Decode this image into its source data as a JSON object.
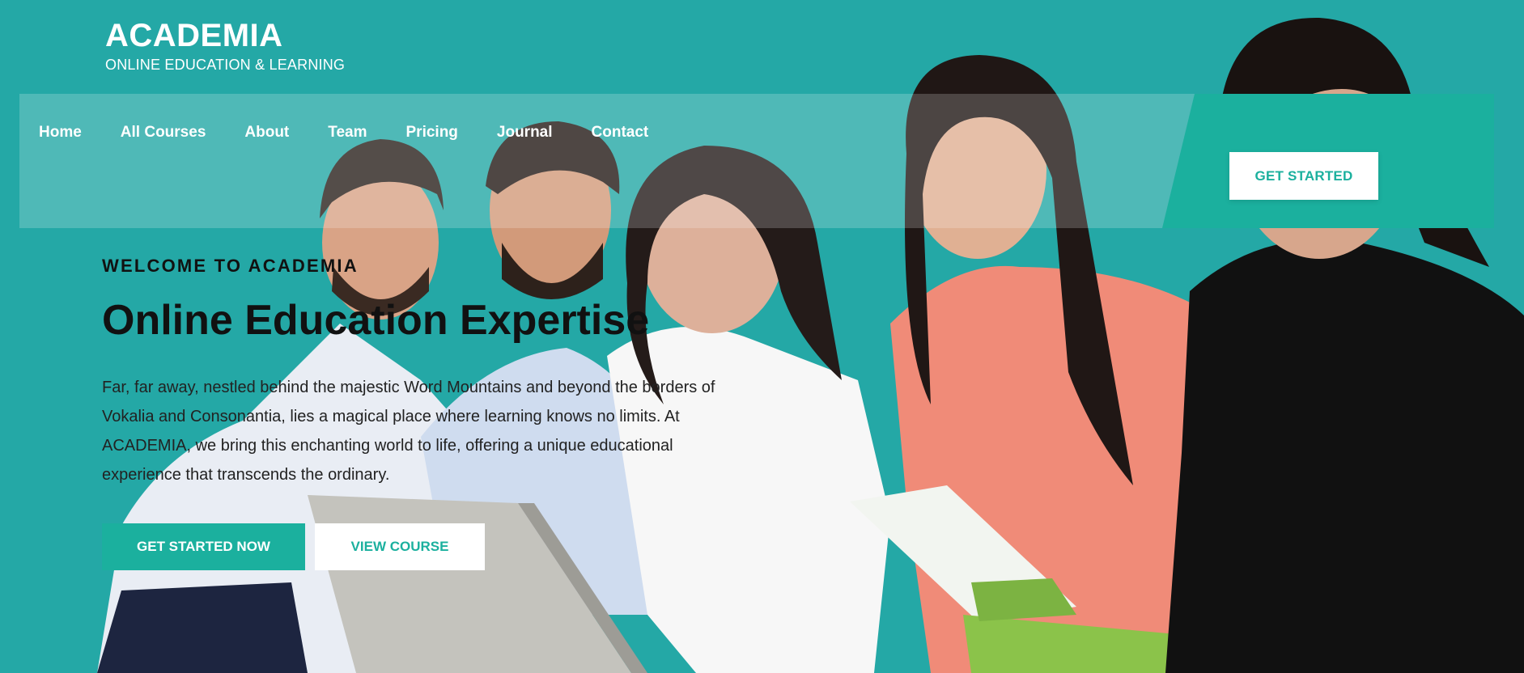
{
  "brand": {
    "name": "ACADEMIA",
    "tagline": "ONLINE EDUCATION & LEARNING"
  },
  "nav": {
    "items": [
      {
        "label": "Home"
      },
      {
        "label": "All Courses"
      },
      {
        "label": "About"
      },
      {
        "label": "Team"
      },
      {
        "label": "Pricing"
      },
      {
        "label": "Journal"
      },
      {
        "label": "Contact"
      }
    ],
    "cta": "GET STARTED"
  },
  "hero": {
    "eyebrow": "WELCOME TO ACADEMIA",
    "title": "Online Education Expertise",
    "description": "Far, far away, nestled behind the majestic Word Mountains and beyond the borders of Vokalia and Consonantia, lies a magical place where learning knows no limits. At ACADEMIA, we bring this enchanting world to life, offering a unique educational experience that transcends the ordinary.",
    "primary_button": "GET STARTED NOW",
    "secondary_button": "VIEW COURSE"
  },
  "colors": {
    "background": "#24a8a6",
    "accent": "#1bb09e",
    "text": "#111111"
  }
}
